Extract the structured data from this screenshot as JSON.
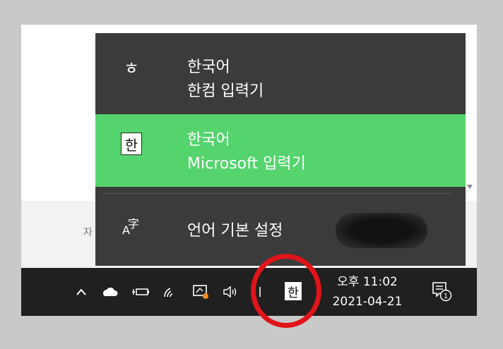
{
  "background": {
    "partial_text": "자"
  },
  "flyout": {
    "items": [
      {
        "name": "hancom",
        "icon": "hangul-ieung-icon",
        "icon_glyph": "ㅎ",
        "line1": "한국어",
        "line2": "한컴 입력기",
        "selected": false
      },
      {
        "name": "microsoft",
        "icon": "han-ime-icon",
        "icon_glyph": "한",
        "line1": "한국어",
        "line2": "Microsoft 입력기",
        "selected": true
      },
      {
        "name": "language-preferences",
        "icon": "language-settings-icon",
        "icon_glyph": "字",
        "line1": "언어 기본 설정"
      }
    ],
    "colors": {
      "background": "#3b3b3b",
      "selected": "#55d46e"
    }
  },
  "taskbar": {
    "icons": [
      "chevron-up-icon",
      "onedrive-cloud-icon",
      "battery-icon",
      "wifi-icon",
      "remote-monitor-icon",
      "volume-icon",
      "ime-mode-icon"
    ],
    "ime_mode": "한",
    "clock_time": "오후 11:02",
    "clock_date": "2021-04-21",
    "notification_count": "1"
  },
  "annotation": {
    "color": "#e1141a"
  }
}
